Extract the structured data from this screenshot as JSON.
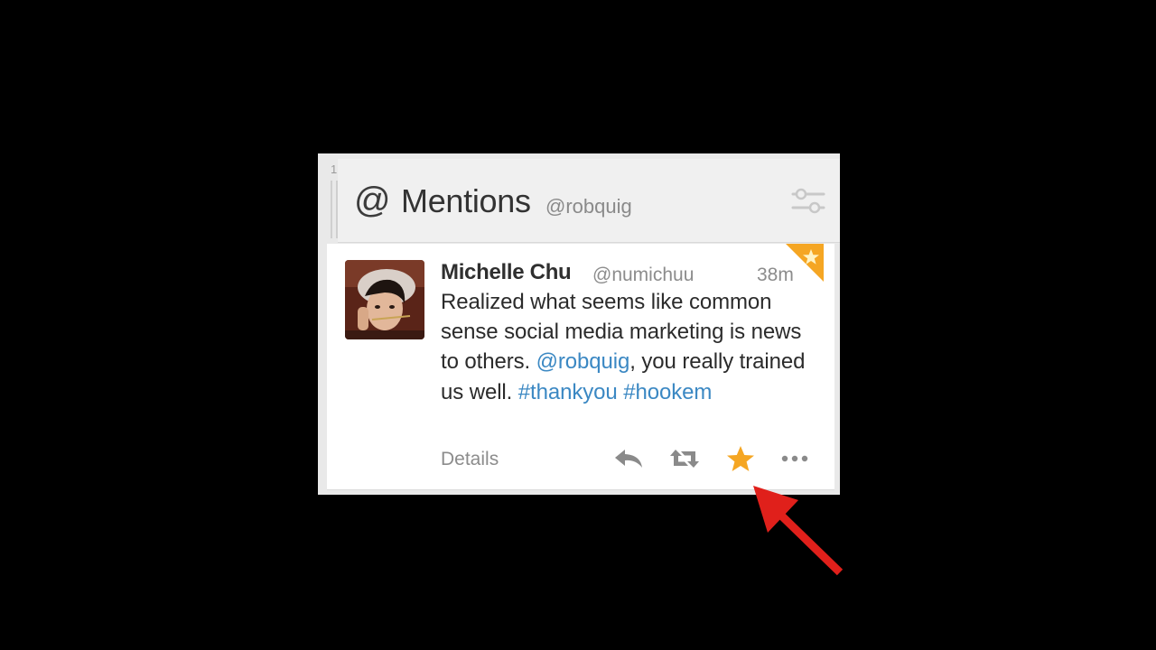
{
  "column": {
    "index": "1",
    "header": {
      "icon": "at-icon",
      "at_symbol": "@",
      "title": "Mentions",
      "handle": "@robquig",
      "settings_icon": "column-settings-icon"
    }
  },
  "tweet": {
    "author_name": "Michelle Chu",
    "author_handle": "@numichuu",
    "timestamp": "38m",
    "text": {
      "part1": "Realized what seems like common sense social media marketing is news to others. ",
      "mention": "@robquig",
      "part2": ", you really trained us well. ",
      "hashtag1": "#thankyou",
      "space": " ",
      "hashtag2": "#hookem"
    },
    "details_label": "Details",
    "actions": [
      "reply-icon",
      "retweet-icon",
      "favorite-star-icon",
      "more-icon"
    ],
    "favorited": true
  },
  "colors": {
    "background": "#000000",
    "link": "#3b88c3",
    "favorite": "#f5a623",
    "arrow": "#e0201b"
  }
}
